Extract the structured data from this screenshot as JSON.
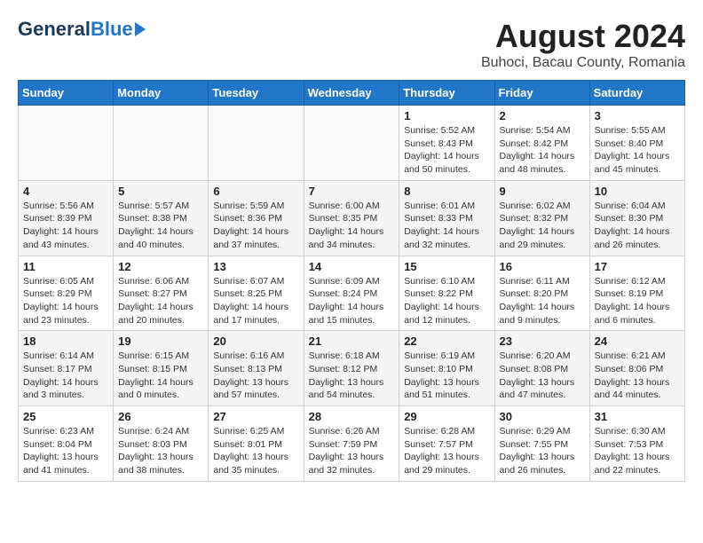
{
  "header": {
    "logo_general": "General",
    "logo_blue": "Blue",
    "month_year": "August 2024",
    "location": "Buhoci, Bacau County, Romania"
  },
  "days_of_week": [
    "Sunday",
    "Monday",
    "Tuesday",
    "Wednesday",
    "Thursday",
    "Friday",
    "Saturday"
  ],
  "weeks": [
    [
      {
        "day": "",
        "info": ""
      },
      {
        "day": "",
        "info": ""
      },
      {
        "day": "",
        "info": ""
      },
      {
        "day": "",
        "info": ""
      },
      {
        "day": "1",
        "info": "Sunrise: 5:52 AM\nSunset: 8:43 PM\nDaylight: 14 hours and 50 minutes."
      },
      {
        "day": "2",
        "info": "Sunrise: 5:54 AM\nSunset: 8:42 PM\nDaylight: 14 hours and 48 minutes."
      },
      {
        "day": "3",
        "info": "Sunrise: 5:55 AM\nSunset: 8:40 PM\nDaylight: 14 hours and 45 minutes."
      }
    ],
    [
      {
        "day": "4",
        "info": "Sunrise: 5:56 AM\nSunset: 8:39 PM\nDaylight: 14 hours and 43 minutes."
      },
      {
        "day": "5",
        "info": "Sunrise: 5:57 AM\nSunset: 8:38 PM\nDaylight: 14 hours and 40 minutes."
      },
      {
        "day": "6",
        "info": "Sunrise: 5:59 AM\nSunset: 8:36 PM\nDaylight: 14 hours and 37 minutes."
      },
      {
        "day": "7",
        "info": "Sunrise: 6:00 AM\nSunset: 8:35 PM\nDaylight: 14 hours and 34 minutes."
      },
      {
        "day": "8",
        "info": "Sunrise: 6:01 AM\nSunset: 8:33 PM\nDaylight: 14 hours and 32 minutes."
      },
      {
        "day": "9",
        "info": "Sunrise: 6:02 AM\nSunset: 8:32 PM\nDaylight: 14 hours and 29 minutes."
      },
      {
        "day": "10",
        "info": "Sunrise: 6:04 AM\nSunset: 8:30 PM\nDaylight: 14 hours and 26 minutes."
      }
    ],
    [
      {
        "day": "11",
        "info": "Sunrise: 6:05 AM\nSunset: 8:29 PM\nDaylight: 14 hours and 23 minutes."
      },
      {
        "day": "12",
        "info": "Sunrise: 6:06 AM\nSunset: 8:27 PM\nDaylight: 14 hours and 20 minutes."
      },
      {
        "day": "13",
        "info": "Sunrise: 6:07 AM\nSunset: 8:25 PM\nDaylight: 14 hours and 17 minutes."
      },
      {
        "day": "14",
        "info": "Sunrise: 6:09 AM\nSunset: 8:24 PM\nDaylight: 14 hours and 15 minutes."
      },
      {
        "day": "15",
        "info": "Sunrise: 6:10 AM\nSunset: 8:22 PM\nDaylight: 14 hours and 12 minutes."
      },
      {
        "day": "16",
        "info": "Sunrise: 6:11 AM\nSunset: 8:20 PM\nDaylight: 14 hours and 9 minutes."
      },
      {
        "day": "17",
        "info": "Sunrise: 6:12 AM\nSunset: 8:19 PM\nDaylight: 14 hours and 6 minutes."
      }
    ],
    [
      {
        "day": "18",
        "info": "Sunrise: 6:14 AM\nSunset: 8:17 PM\nDaylight: 14 hours and 3 minutes."
      },
      {
        "day": "19",
        "info": "Sunrise: 6:15 AM\nSunset: 8:15 PM\nDaylight: 14 hours and 0 minutes."
      },
      {
        "day": "20",
        "info": "Sunrise: 6:16 AM\nSunset: 8:13 PM\nDaylight: 13 hours and 57 minutes."
      },
      {
        "day": "21",
        "info": "Sunrise: 6:18 AM\nSunset: 8:12 PM\nDaylight: 13 hours and 54 minutes."
      },
      {
        "day": "22",
        "info": "Sunrise: 6:19 AM\nSunset: 8:10 PM\nDaylight: 13 hours and 51 minutes."
      },
      {
        "day": "23",
        "info": "Sunrise: 6:20 AM\nSunset: 8:08 PM\nDaylight: 13 hours and 47 minutes."
      },
      {
        "day": "24",
        "info": "Sunrise: 6:21 AM\nSunset: 8:06 PM\nDaylight: 13 hours and 44 minutes."
      }
    ],
    [
      {
        "day": "25",
        "info": "Sunrise: 6:23 AM\nSunset: 8:04 PM\nDaylight: 13 hours and 41 minutes."
      },
      {
        "day": "26",
        "info": "Sunrise: 6:24 AM\nSunset: 8:03 PM\nDaylight: 13 hours and 38 minutes."
      },
      {
        "day": "27",
        "info": "Sunrise: 6:25 AM\nSunset: 8:01 PM\nDaylight: 13 hours and 35 minutes."
      },
      {
        "day": "28",
        "info": "Sunrise: 6:26 AM\nSunset: 7:59 PM\nDaylight: 13 hours and 32 minutes."
      },
      {
        "day": "29",
        "info": "Sunrise: 6:28 AM\nSunset: 7:57 PM\nDaylight: 13 hours and 29 minutes."
      },
      {
        "day": "30",
        "info": "Sunrise: 6:29 AM\nSunset: 7:55 PM\nDaylight: 13 hours and 26 minutes."
      },
      {
        "day": "31",
        "info": "Sunrise: 6:30 AM\nSunset: 7:53 PM\nDaylight: 13 hours and 22 minutes."
      }
    ]
  ]
}
